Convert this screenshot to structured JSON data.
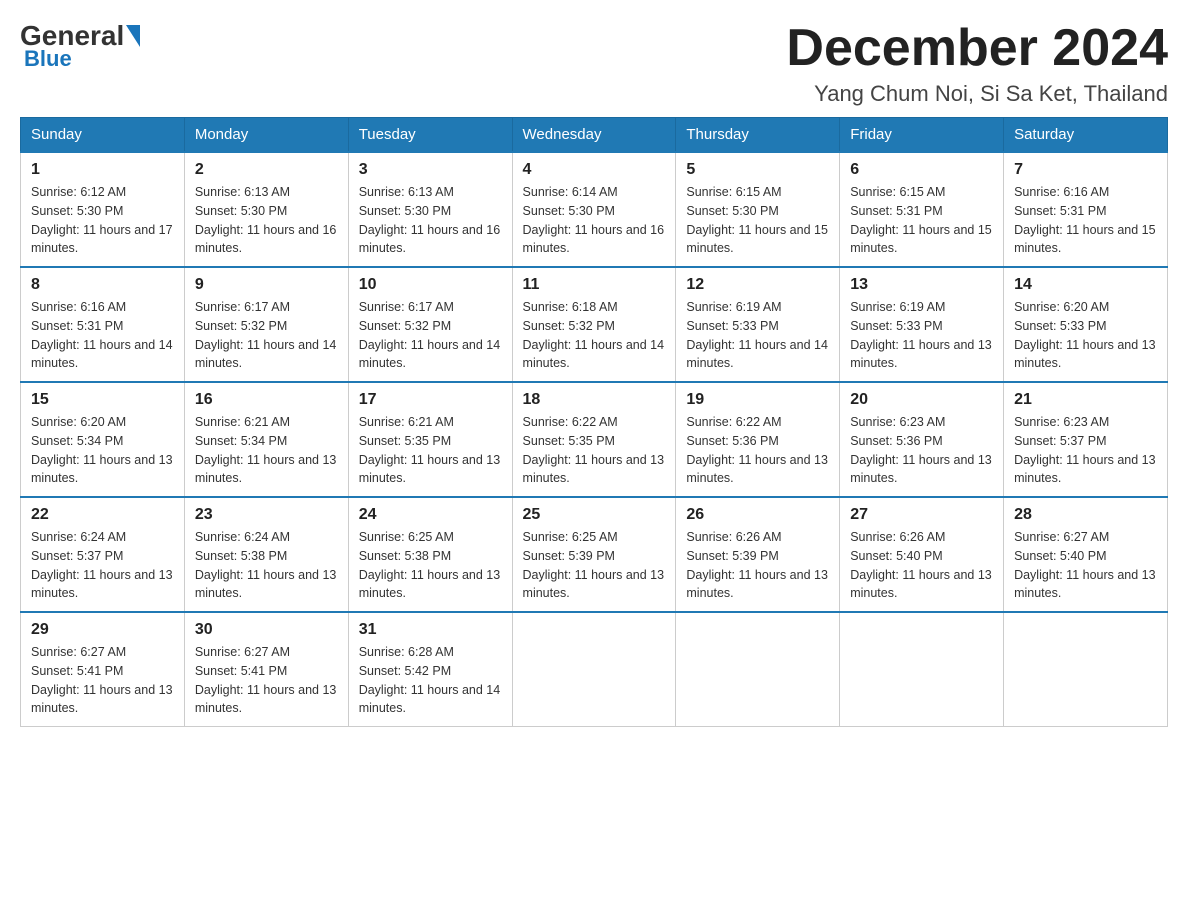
{
  "logo": {
    "general": "General",
    "blue": "Blue"
  },
  "title": {
    "month": "December 2024",
    "location": "Yang Chum Noi, Si Sa Ket, Thailand"
  },
  "weekdays": [
    "Sunday",
    "Monday",
    "Tuesday",
    "Wednesday",
    "Thursday",
    "Friday",
    "Saturday"
  ],
  "weeks": [
    [
      {
        "day": "1",
        "sunrise": "6:12 AM",
        "sunset": "5:30 PM",
        "daylight": "11 hours and 17 minutes."
      },
      {
        "day": "2",
        "sunrise": "6:13 AM",
        "sunset": "5:30 PM",
        "daylight": "11 hours and 16 minutes."
      },
      {
        "day": "3",
        "sunrise": "6:13 AM",
        "sunset": "5:30 PM",
        "daylight": "11 hours and 16 minutes."
      },
      {
        "day": "4",
        "sunrise": "6:14 AM",
        "sunset": "5:30 PM",
        "daylight": "11 hours and 16 minutes."
      },
      {
        "day": "5",
        "sunrise": "6:15 AM",
        "sunset": "5:30 PM",
        "daylight": "11 hours and 15 minutes."
      },
      {
        "day": "6",
        "sunrise": "6:15 AM",
        "sunset": "5:31 PM",
        "daylight": "11 hours and 15 minutes."
      },
      {
        "day": "7",
        "sunrise": "6:16 AM",
        "sunset": "5:31 PM",
        "daylight": "11 hours and 15 minutes."
      }
    ],
    [
      {
        "day": "8",
        "sunrise": "6:16 AM",
        "sunset": "5:31 PM",
        "daylight": "11 hours and 14 minutes."
      },
      {
        "day": "9",
        "sunrise": "6:17 AM",
        "sunset": "5:32 PM",
        "daylight": "11 hours and 14 minutes."
      },
      {
        "day": "10",
        "sunrise": "6:17 AM",
        "sunset": "5:32 PM",
        "daylight": "11 hours and 14 minutes."
      },
      {
        "day": "11",
        "sunrise": "6:18 AM",
        "sunset": "5:32 PM",
        "daylight": "11 hours and 14 minutes."
      },
      {
        "day": "12",
        "sunrise": "6:19 AM",
        "sunset": "5:33 PM",
        "daylight": "11 hours and 14 minutes."
      },
      {
        "day": "13",
        "sunrise": "6:19 AM",
        "sunset": "5:33 PM",
        "daylight": "11 hours and 13 minutes."
      },
      {
        "day": "14",
        "sunrise": "6:20 AM",
        "sunset": "5:33 PM",
        "daylight": "11 hours and 13 minutes."
      }
    ],
    [
      {
        "day": "15",
        "sunrise": "6:20 AM",
        "sunset": "5:34 PM",
        "daylight": "11 hours and 13 minutes."
      },
      {
        "day": "16",
        "sunrise": "6:21 AM",
        "sunset": "5:34 PM",
        "daylight": "11 hours and 13 minutes."
      },
      {
        "day": "17",
        "sunrise": "6:21 AM",
        "sunset": "5:35 PM",
        "daylight": "11 hours and 13 minutes."
      },
      {
        "day": "18",
        "sunrise": "6:22 AM",
        "sunset": "5:35 PM",
        "daylight": "11 hours and 13 minutes."
      },
      {
        "day": "19",
        "sunrise": "6:22 AM",
        "sunset": "5:36 PM",
        "daylight": "11 hours and 13 minutes."
      },
      {
        "day": "20",
        "sunrise": "6:23 AM",
        "sunset": "5:36 PM",
        "daylight": "11 hours and 13 minutes."
      },
      {
        "day": "21",
        "sunrise": "6:23 AM",
        "sunset": "5:37 PM",
        "daylight": "11 hours and 13 minutes."
      }
    ],
    [
      {
        "day": "22",
        "sunrise": "6:24 AM",
        "sunset": "5:37 PM",
        "daylight": "11 hours and 13 minutes."
      },
      {
        "day": "23",
        "sunrise": "6:24 AM",
        "sunset": "5:38 PM",
        "daylight": "11 hours and 13 minutes."
      },
      {
        "day": "24",
        "sunrise": "6:25 AM",
        "sunset": "5:38 PM",
        "daylight": "11 hours and 13 minutes."
      },
      {
        "day": "25",
        "sunrise": "6:25 AM",
        "sunset": "5:39 PM",
        "daylight": "11 hours and 13 minutes."
      },
      {
        "day": "26",
        "sunrise": "6:26 AM",
        "sunset": "5:39 PM",
        "daylight": "11 hours and 13 minutes."
      },
      {
        "day": "27",
        "sunrise": "6:26 AM",
        "sunset": "5:40 PM",
        "daylight": "11 hours and 13 minutes."
      },
      {
        "day": "28",
        "sunrise": "6:27 AM",
        "sunset": "5:40 PM",
        "daylight": "11 hours and 13 minutes."
      }
    ],
    [
      {
        "day": "29",
        "sunrise": "6:27 AM",
        "sunset": "5:41 PM",
        "daylight": "11 hours and 13 minutes."
      },
      {
        "day": "30",
        "sunrise": "6:27 AM",
        "sunset": "5:41 PM",
        "daylight": "11 hours and 13 minutes."
      },
      {
        "day": "31",
        "sunrise": "6:28 AM",
        "sunset": "5:42 PM",
        "daylight": "11 hours and 14 minutes."
      },
      null,
      null,
      null,
      null
    ]
  ],
  "labels": {
    "sunrise_prefix": "Sunrise: ",
    "sunset_prefix": "Sunset: ",
    "daylight_prefix": "Daylight: "
  }
}
